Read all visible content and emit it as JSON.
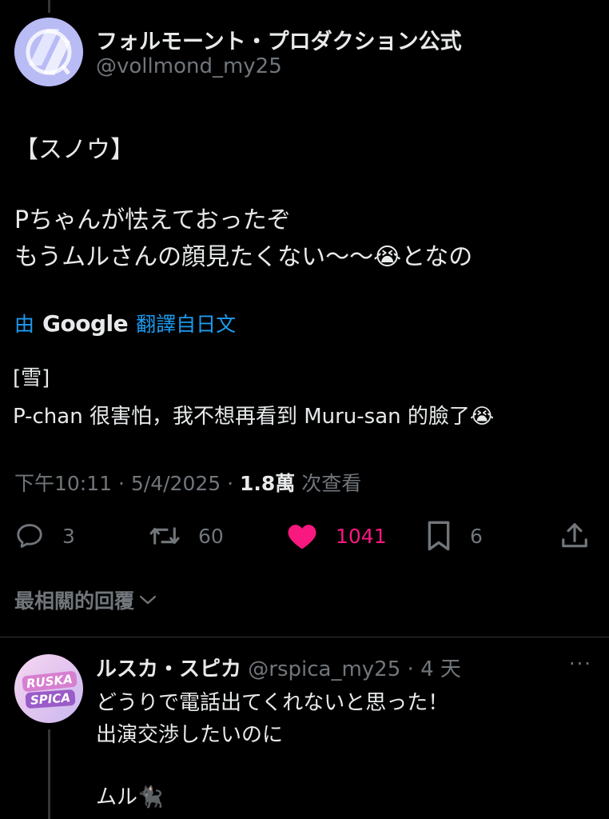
{
  "tweet": {
    "display_name": "フォルモーント・プロダクション公式",
    "handle": "@vollmond_my25",
    "lines": [
      "【スノウ】",
      "Pちゃんが怯えておったぞ",
      "もうムルさんの顔見たくない〜〜😭となの"
    ],
    "translation": {
      "prefix": "由",
      "google": "Google",
      "suffix": "翻譯自日文",
      "lines": [
        "[雪]",
        "P-chan 很害怕，我不想再看到 Muru-san 的臉了😭"
      ]
    },
    "meta": {
      "time": "下午10:11 · 5/4/2025 · ",
      "views": "1.8萬",
      "views_label": " 次查看"
    },
    "actions": {
      "reply_count": "3",
      "retweet_count": "60",
      "like_count": "1041",
      "bookmark_count": "6"
    },
    "colors": {
      "like": "#f91880",
      "link": "#1d9bf0",
      "muted": "#71767b"
    }
  },
  "replies_sort_label": "最相關的回覆",
  "reply": {
    "display_name": "ルスカ・スピカ",
    "handle": " @rspica_my25 · 4 天",
    "avatar_text_1": "RUSKA",
    "avatar_text_2": "SPICA",
    "more": "···",
    "lines": [
      "どうりで電話出てくれないと思った！",
      "出演交渉したいのに",
      "ムル🐈‍⬛"
    ]
  }
}
